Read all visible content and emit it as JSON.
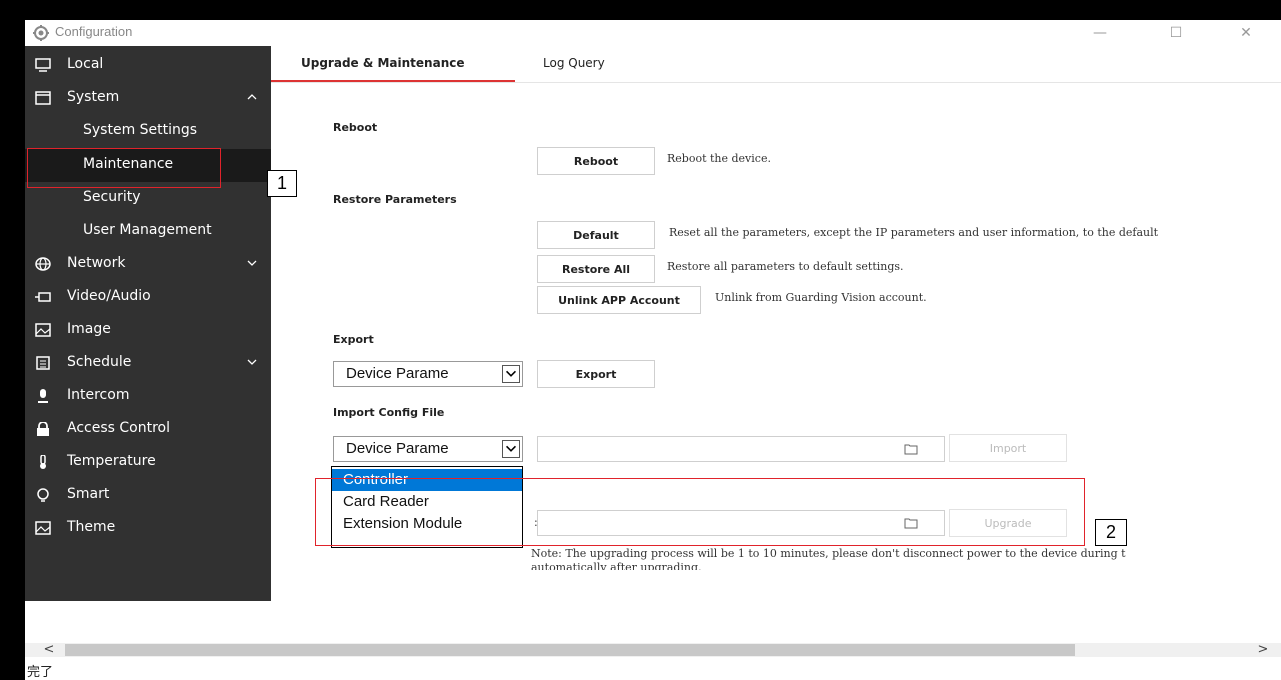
{
  "window": {
    "title": "Configuration",
    "minimize": "—",
    "maximize": "☐",
    "close": "✕"
  },
  "sidebar": {
    "items": [
      {
        "label": "Local",
        "icon": "monitor-icon"
      },
      {
        "label": "System",
        "icon": "window-icon",
        "expanded": true
      },
      {
        "label": "System Settings"
      },
      {
        "label": "Maintenance",
        "active": true
      },
      {
        "label": "Security"
      },
      {
        "label": "User Management"
      },
      {
        "label": "Network",
        "icon": "globe-icon"
      },
      {
        "label": "Video/Audio",
        "icon": "video-icon"
      },
      {
        "label": "Image",
        "icon": "image-icon"
      },
      {
        "label": "Schedule",
        "icon": "calendar-icon"
      },
      {
        "label": "Intercom",
        "icon": "microphone-icon"
      },
      {
        "label": "Access Control",
        "icon": "lock-icon"
      },
      {
        "label": "Temperature",
        "icon": "thermometer-icon"
      },
      {
        "label": "Smart",
        "icon": "bulb-icon"
      },
      {
        "label": "Theme",
        "icon": "theme-icon"
      }
    ]
  },
  "tabs": [
    {
      "label": "Upgrade & Maintenance",
      "active": true
    },
    {
      "label": "Log Query"
    }
  ],
  "reboot": {
    "title": "Reboot",
    "button": "Reboot",
    "desc": "Reboot the device."
  },
  "restore": {
    "title": "Restore Parameters",
    "default_button": "Default",
    "default_desc": "Reset all the parameters, except the IP parameters and user information, to the default",
    "restore_all_button": "Restore All",
    "restore_all_desc": "Restore all parameters to default settings.",
    "unlink_button": "Unlink APP Account",
    "unlink_desc": "Unlink from Guarding Vision account."
  },
  "export": {
    "title": "Export",
    "select_value": "Device Parame",
    "button": "Export"
  },
  "import": {
    "title": "Import Config File",
    "select_value": "Device Parame",
    "button": "Import"
  },
  "upgrade": {
    "label_fragment": ":",
    "button": "Upgrade",
    "note_line1": "Note: The upgrading process will be 1 to 10 minutes, please don't disconnect power to the device during t",
    "note_line2": "automatically after upgrading."
  },
  "dropdown": {
    "options": [
      "Controller",
      "Card Reader",
      "Extension Module"
    ],
    "selected": "Controller"
  },
  "annotations": {
    "box1": "1",
    "box2": "2"
  },
  "scrollbar": {
    "left": "<",
    "right": ">"
  },
  "status": {
    "text": "完了"
  },
  "colors": {
    "sidebar_bg": "#313131",
    "accent_red": "#e0232b",
    "selection_blue": "#0078d7"
  }
}
